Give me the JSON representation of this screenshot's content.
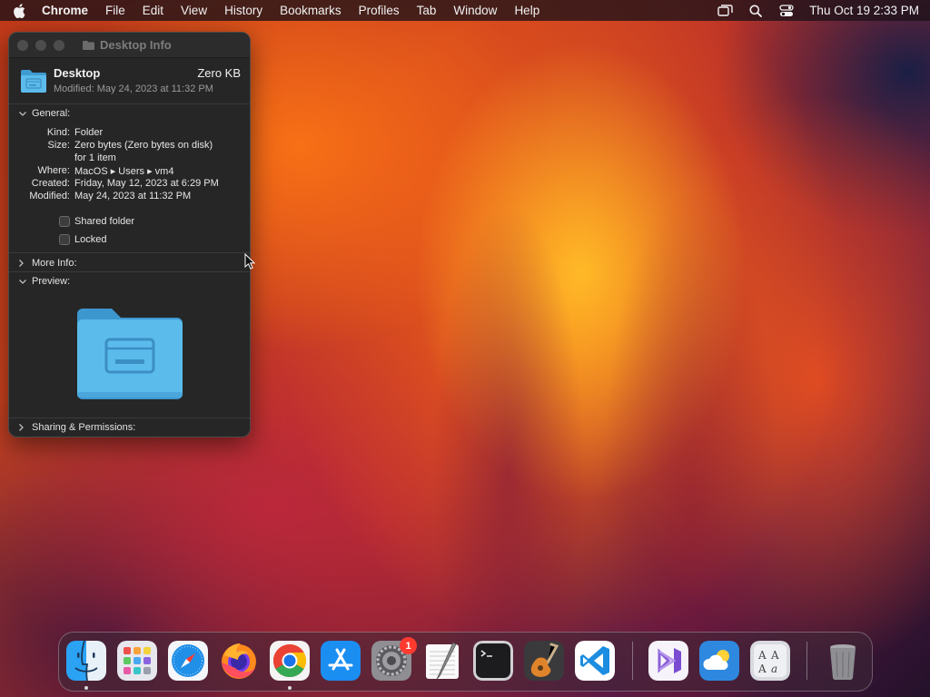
{
  "menubar": {
    "app_name": "Chrome",
    "items": [
      "File",
      "Edit",
      "View",
      "History",
      "Bookmarks",
      "Profiles",
      "Tab",
      "Window",
      "Help"
    ],
    "clock": "Thu Oct 19  2:33 PM",
    "status_icons": [
      "screen-mirroring-icon",
      "search-icon",
      "control-center-icon"
    ]
  },
  "info_window": {
    "title": "Desktop Info",
    "header": {
      "name": "Desktop",
      "size": "Zero KB",
      "modified": "Modified: May 24, 2023 at 11:32 PM"
    },
    "general": {
      "label": "General:",
      "rows": [
        {
          "label": "Kind:",
          "value": "Folder"
        },
        {
          "label": "Size:",
          "value": "Zero bytes (Zero bytes on disk)"
        },
        {
          "label": "",
          "value": "for 1 item"
        },
        {
          "label": "Where:",
          "value": "MacOS ▸ Users ▸ vm4"
        },
        {
          "label": "Created:",
          "value": "Friday, May 12, 2023 at 6:29 PM"
        },
        {
          "label": "Modified:",
          "value": "May 24, 2023 at 11:32 PM"
        }
      ],
      "shared_folder": "Shared folder",
      "locked": "Locked"
    },
    "more_info": "More Info:",
    "preview": "Preview:",
    "sharing": "Sharing & Permissions:"
  },
  "dock": {
    "apps": [
      "finder",
      "launchpad",
      "safari",
      "firefox",
      "chrome",
      "app-store",
      "system-settings",
      "textedit",
      "terminal",
      "garageband",
      "vscode",
      "visual-studio",
      "weather",
      "font-book",
      "trash"
    ],
    "settings_badge": "1"
  },
  "colors": {
    "folder_blue": "#5bbcec",
    "window_bg": "#262626",
    "badge_red": "#ff3b30"
  }
}
